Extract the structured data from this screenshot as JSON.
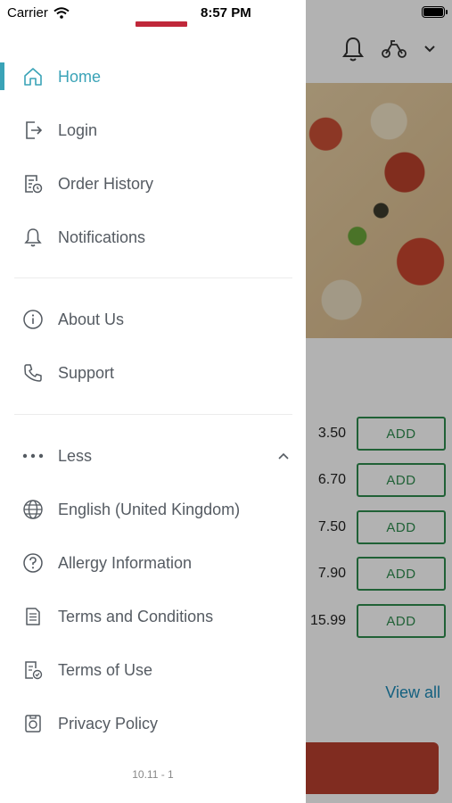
{
  "status_bar": {
    "carrier": "Carrier",
    "time": "8:57 PM"
  },
  "drawer": {
    "items_primary": [
      {
        "label": "Home",
        "icon": "home-icon",
        "active": true
      },
      {
        "label": "Login",
        "icon": "login-icon"
      },
      {
        "label": "Order History",
        "icon": "order-history-icon"
      },
      {
        "label": "Notifications",
        "icon": "bell-icon"
      }
    ],
    "items_secondary": [
      {
        "label": "About Us",
        "icon": "info-icon"
      },
      {
        "label": "Support",
        "icon": "phone-icon"
      }
    ],
    "less_label": "Less",
    "items_more": [
      {
        "label": "English (United Kingdom)",
        "icon": "globe-icon"
      },
      {
        "label": "Allergy Information",
        "icon": "question-icon"
      },
      {
        "label": "Terms and Conditions",
        "icon": "document-icon"
      },
      {
        "label": "Terms of Use",
        "icon": "document-check-icon"
      },
      {
        "label": "Privacy Policy",
        "icon": "privacy-icon"
      }
    ],
    "version": "10.11 - 1",
    "accent_color": "#3aa3b7"
  },
  "background": {
    "prices": [
      "3.50",
      "6.70",
      "7.50",
      "7.90",
      "15.99"
    ],
    "add_label": "ADD",
    "view_all": "View all"
  }
}
